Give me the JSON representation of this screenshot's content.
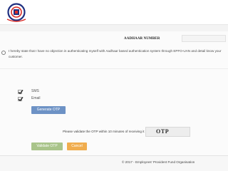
{
  "header": {
    "logo_icon": "epfo-emblem-icon",
    "logo_colors": {
      "primary": "#1f2f80",
      "accent": "#d92b26"
    }
  },
  "aadhaar": {
    "label": "AADHAAR NUMBER",
    "value": ""
  },
  "consent": {
    "text": "I hereby state that I have no objection in authenticating myself with Aadhaar based authentication system through EPFO-UAN and detail know your customer."
  },
  "channels": [
    {
      "label": "SMS",
      "checked": true
    },
    {
      "label": "Email",
      "checked": true
    }
  ],
  "buttons": {
    "generate_otp": "Generate OTP",
    "validate_otp": "Validate OTP",
    "cancel": "Cancel"
  },
  "otp": {
    "prompt": "Please validate the OTP within 10 minutes of receiving it",
    "captcha_text": "OTP"
  },
  "footer": {
    "text": "© 2017 - Employees' Provident Fund Organisation"
  },
  "colors": {
    "generate_button": "#6d92c5",
    "validate_button": "#a9c48a",
    "cancel_button": "#f0ad4e"
  }
}
